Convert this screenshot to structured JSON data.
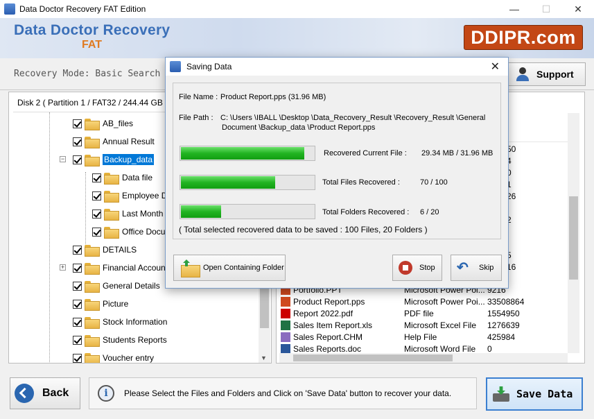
{
  "window": {
    "title": "Data Doctor Recovery FAT Edition",
    "minimize": "—",
    "maximize": "☐",
    "close": "✕"
  },
  "header": {
    "brand_main": "Data Doctor Recovery",
    "brand_sub": "FAT",
    "logo_text": "DDIPR.com"
  },
  "modebar": {
    "mode_text": "Recovery Mode: Basic Search",
    "support_label": "Support"
  },
  "left_panel": {
    "disk_label": "Disk 2 ( Partition 1 / FAT32 / 244.44 GB )",
    "tree": [
      {
        "label": "AB_files"
      },
      {
        "label": "Annual Result"
      },
      {
        "label": "Backup_data"
      },
      {
        "label": "Data file"
      },
      {
        "label": "Employee Det"
      },
      {
        "label": "Last Month Da"
      },
      {
        "label": "Office Docum"
      },
      {
        "label": "DETAILS"
      },
      {
        "label": "Financial Accounting"
      },
      {
        "label": "General Details"
      },
      {
        "label": "Picture"
      },
      {
        "label": "Stock Information"
      },
      {
        "label": "Students Reports"
      },
      {
        "label": "Voucher entry"
      }
    ]
  },
  "right_panel": {
    "partial_sizes": [
      "50",
      "4",
      "0",
      "1",
      "26",
      "2",
      "5",
      "16"
    ],
    "files": [
      {
        "name": "Portfolio.PPT",
        "type": "Microsoft Power Poi...",
        "size": "9216",
        "icon": "ppt"
      },
      {
        "name": "Product Report.pps",
        "type": "Microsoft Power Poi...",
        "size": "33508864",
        "icon": "ppt"
      },
      {
        "name": "Report 2022.pdf",
        "type": "PDF file",
        "size": "1554950",
        "icon": "pdf"
      },
      {
        "name": "Sales Item Report.xls",
        "type": "Microsoft Excel File",
        "size": "1276639",
        "icon": "xls"
      },
      {
        "name": "Sales Report.CHM",
        "type": "Help File",
        "size": "425984",
        "icon": "chm"
      },
      {
        "name": "Sales Reports.doc",
        "type": "Microsoft Word File",
        "size": "0",
        "icon": "doc"
      }
    ]
  },
  "dialog": {
    "title": "Saving Data",
    "close": "✕",
    "file_name_label": "File Name :",
    "file_name_value": "Product Report.pps (31.96 MB)",
    "file_path_label": "File Path :",
    "file_path_line1": "C: \\Users \\IBALL \\Desktop \\Data_Recovery_Result \\Recovery_Result \\General",
    "file_path_line2": "Document \\Backup_data \\Product Report.pps",
    "progress": [
      {
        "label": "Recovered Current File :",
        "value": "29.34 MB  /  31.96 MB",
        "fraction": 0.918
      },
      {
        "label": "Total Files Recovered :",
        "value": "70 / 100",
        "fraction": 0.7
      },
      {
        "label": "Total Folders Recovered :",
        "value": "6 / 20",
        "fraction": 0.3
      }
    ],
    "summary": "( Total selected recovered data to be saved : 100 Files, 20 Folders )",
    "open_folder_label": "Open Containing Folder",
    "stop_label": "Stop",
    "skip_label": "Skip"
  },
  "bottombar": {
    "back_label": "Back",
    "info_message": "Please Select the Files and Folders and Click on 'Save Data' button to recover your data.",
    "save_label": "Save Data"
  }
}
